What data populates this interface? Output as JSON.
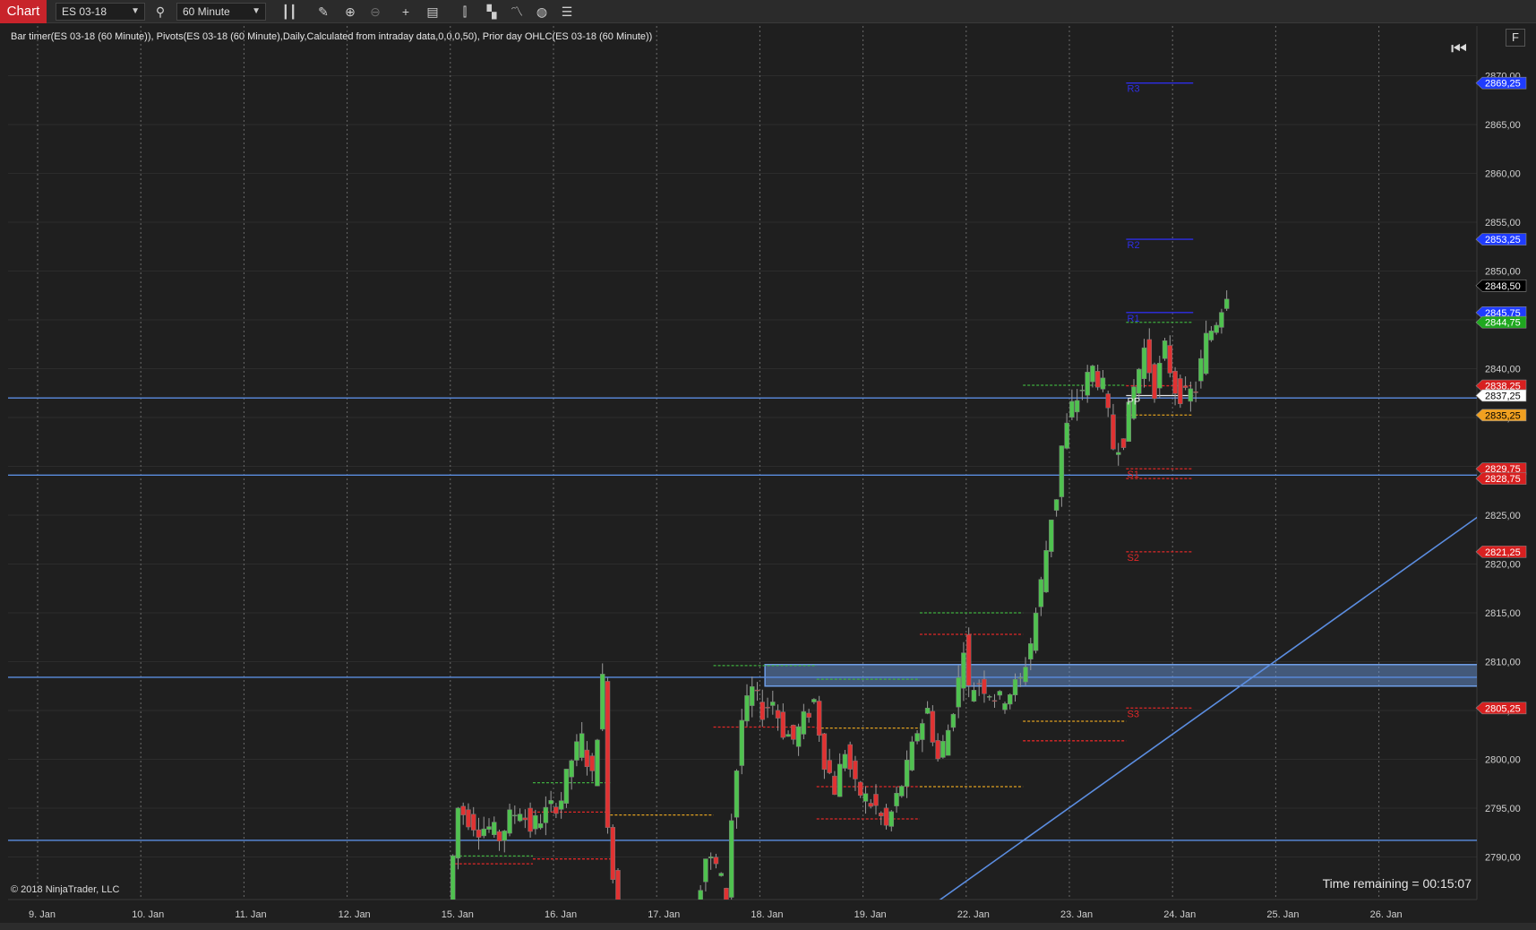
{
  "toolbar": {
    "chart_tab": "Chart",
    "instrument": "ES 03-18",
    "interval": "60 Minute",
    "icons": [
      "bar-type-icon",
      "draw-pencil-icon",
      "zoom-in-icon",
      "zoom-out-icon",
      "crosshair-icon",
      "data-box-icon",
      "bar-spacing-icon",
      "toggle-rows-icon",
      "strategy-icon",
      "refresh-icon",
      "properties-icon"
    ]
  },
  "indicator_label": "Bar timer(ES 03-18 (60 Minute)), Pivots(ES 03-18 (60 Minute),Daily,Calculated from intraday data,0,0,0,50), Prior day OHLC(ES 03-18 (60 Minute))",
  "copyright": "© 2018 NinjaTrader, LLC",
  "time_remaining": "Time remaining = 00:15:07",
  "f_button": "F",
  "chart_data": {
    "type": "candlestick",
    "instrument": "ES 03-18",
    "interval": "60 Minute",
    "x_ticks": [
      "9. Jan",
      "10. Jan",
      "11. Jan",
      "12. Jan",
      "15. Jan",
      "16. Jan",
      "17. Jan",
      "18. Jan",
      "19. Jan",
      "22. Jan",
      "23. Jan",
      "24. Jan",
      "25. Jan",
      "26. Jan"
    ],
    "y_ticks": [
      "2870,00",
      "2865,00",
      "2860,00",
      "2855,00",
      "2850,00",
      "2845,00",
      "2840,00",
      "2835,00",
      "2830,00",
      "2825,00",
      "2820,00",
      "2815,00",
      "2810,00",
      "2805,00",
      "2800,00",
      "2795,00",
      "2790,00"
    ],
    "y_tick_values": [
      2870,
      2865,
      2860,
      2855,
      2850,
      2845,
      2840,
      2835,
      2830,
      2825,
      2820,
      2815,
      2810,
      2805,
      2800,
      2795,
      2790
    ],
    "ylim": [
      2785.3,
      2874.5
    ],
    "grid": true,
    "colors": {
      "up": "#4fc24f",
      "down": "#e03232",
      "horizontal_line": "#5b8de0",
      "zone": "#6f9fe8",
      "r_levels": "#2e2ee8",
      "s_levels": "#e02828",
      "pp": "#e8e8e8",
      "prior_open": "#e0a020"
    },
    "price_labels": [
      {
        "text": "2869,25",
        "value": 2869.25,
        "bg": "#1f3cff",
        "fg": "#ffffff"
      },
      {
        "text": "2853,25",
        "value": 2853.25,
        "bg": "#1f3cff",
        "fg": "#ffffff"
      },
      {
        "text": "2848,50",
        "value": 2848.5,
        "bg": "#000000",
        "fg": "#ffffff"
      },
      {
        "text": "2845,75",
        "value": 2845.75,
        "bg": "#1f3cff",
        "fg": "#ffffff"
      },
      {
        "text": "2844,75",
        "value": 2844.75,
        "bg": "#1fa81f",
        "fg": "#ffffff"
      },
      {
        "text": "2838,25",
        "value": 2838.25,
        "bg": "#d82020",
        "fg": "#ffffff"
      },
      {
        "text": "2837,25",
        "value": 2837.25,
        "bg": "#ffffff",
        "fg": "#000000"
      },
      {
        "text": "2835,25",
        "value": 2835.25,
        "bg": "#f0a020",
        "fg": "#000000"
      },
      {
        "text": "2829,75",
        "value": 2829.75,
        "bg": "#d82020",
        "fg": "#ffffff"
      },
      {
        "text": "2828,75",
        "value": 2828.75,
        "bg": "#d82020",
        "fg": "#ffffff"
      },
      {
        "text": "2821,25",
        "value": 2821.25,
        "bg": "#d82020",
        "fg": "#ffffff"
      },
      {
        "text": "2805,25",
        "value": 2805.25,
        "bg": "#d82020",
        "fg": "#ffffff"
      }
    ],
    "pivot_labels": [
      {
        "text": "R3",
        "value": 2869.25,
        "color": "#2e2ee8"
      },
      {
        "text": "R2",
        "value": 2853.25,
        "color": "#2e2ee8"
      },
      {
        "text": "R1",
        "value": 2845.75,
        "color": "#2e2ee8"
      },
      {
        "text": "PP",
        "value": 2837.25,
        "color": "#e8e8e8"
      },
      {
        "text": "S1",
        "value": 2829.75,
        "color": "#e02828"
      },
      {
        "text": "S2",
        "value": 2821.25,
        "color": "#e02828"
      },
      {
        "text": "S3",
        "value": 2805.25,
        "color": "#e02828"
      }
    ],
    "horizontal_lines": [
      2837.0,
      2829.1,
      2808.4,
      2791.7
    ],
    "zone": {
      "top": 2809.7,
      "bottom": 2807.5,
      "x_start": 7.05,
      "x_end": 15.25
    },
    "trendline": {
      "x1": 8.0,
      "y1": 2780.0,
      "x2": 15.35,
      "y2": 2835.3
    },
    "level_segments": [
      {
        "x1": 4.0,
        "x2": 4.8,
        "y": 2790.1,
        "color": "#3fae3f"
      },
      {
        "x1": 4.0,
        "x2": 4.8,
        "y": 2789.3,
        "color": "#e02828"
      },
      {
        "x1": 4.8,
        "x2": 5.55,
        "y": 2797.6,
        "color": "#3fae3f"
      },
      {
        "x1": 4.8,
        "x2": 5.55,
        "y": 2794.6,
        "color": "#e02828"
      },
      {
        "x1": 4.8,
        "x2": 5.55,
        "y": 2789.8,
        "color": "#e02828"
      },
      {
        "x1": 5.55,
        "x2": 6.55,
        "y": 2794.3,
        "color": "#e0a020"
      },
      {
        "x1": 6.55,
        "x2": 7.55,
        "y": 2809.6,
        "color": "#3fae3f"
      },
      {
        "x1": 6.55,
        "x2": 7.55,
        "y": 2803.3,
        "color": "#e02828"
      },
      {
        "x1": 7.55,
        "x2": 8.55,
        "y": 2803.2,
        "color": "#e0a020"
      },
      {
        "x1": 7.55,
        "x2": 8.55,
        "y": 2808.2,
        "color": "#3fae3f"
      },
      {
        "x1": 7.55,
        "x2": 8.55,
        "y": 2797.2,
        "color": "#e02828"
      },
      {
        "x1": 7.55,
        "x2": 8.55,
        "y": 2793.9,
        "color": "#e02828"
      },
      {
        "x1": 8.55,
        "x2": 9.55,
        "y": 2815.0,
        "color": "#3fae3f"
      },
      {
        "x1": 8.55,
        "x2": 9.55,
        "y": 2812.8,
        "color": "#e02828"
      },
      {
        "x1": 8.55,
        "x2": 9.55,
        "y": 2797.2,
        "color": "#e0a020"
      },
      {
        "x1": 9.55,
        "x2": 10.55,
        "y": 2838.3,
        "color": "#3fae3f"
      },
      {
        "x1": 9.55,
        "x2": 10.55,
        "y": 2803.9,
        "color": "#e0a020"
      },
      {
        "x1": 9.55,
        "x2": 10.55,
        "y": 2801.9,
        "color": "#e02828"
      },
      {
        "x1": 10.55,
        "x2": 11.2,
        "y": 2869.25,
        "color": "#2e2ee8"
      },
      {
        "x1": 10.55,
        "x2": 11.2,
        "y": 2853.25,
        "color": "#2e2ee8"
      },
      {
        "x1": 10.55,
        "x2": 11.2,
        "y": 2845.75,
        "color": "#2e2ee8"
      },
      {
        "x1": 10.55,
        "x2": 11.2,
        "y": 2844.75,
        "color": "#3fae3f"
      },
      {
        "x1": 10.55,
        "x2": 11.2,
        "y": 2838.25,
        "color": "#e02828"
      },
      {
        "x1": 10.55,
        "x2": 11.2,
        "y": 2837.25,
        "color": "#e8e8e8"
      },
      {
        "x1": 10.55,
        "x2": 11.2,
        "y": 2835.25,
        "color": "#e0a020"
      },
      {
        "x1": 10.55,
        "x2": 11.2,
        "y": 2829.75,
        "color": "#e02828"
      },
      {
        "x1": 10.55,
        "x2": 11.2,
        "y": 2828.75,
        "color": "#e02828"
      },
      {
        "x1": 10.55,
        "x2": 11.2,
        "y": 2821.25,
        "color": "#e02828"
      },
      {
        "x1": 10.55,
        "x2": 11.2,
        "y": 2805.25,
        "color": "#e02828"
      }
    ],
    "price_path": [
      [
        4.0,
        2784
      ],
      [
        4.05,
        2790
      ],
      [
        4.1,
        2795
      ],
      [
        4.2,
        2794
      ],
      [
        4.3,
        2793
      ],
      [
        4.4,
        2793
      ],
      [
        4.5,
        2792
      ],
      [
        4.6,
        2794
      ],
      [
        4.7,
        2795
      ],
      [
        4.8,
        2793
      ],
      [
        4.9,
        2794
      ],
      [
        5.0,
        2795
      ],
      [
        5.1,
        2796
      ],
      [
        5.2,
        2800
      ],
      [
        5.3,
        2802
      ],
      [
        5.4,
        2798
      ],
      [
        5.5,
        2808
      ],
      [
        5.55,
        2794
      ],
      [
        5.6,
        2788
      ],
      [
        5.65,
        2784
      ],
      [
        6.4,
        2785
      ],
      [
        6.5,
        2790
      ],
      [
        6.6,
        2789
      ],
      [
        6.7,
        2786
      ],
      [
        6.75,
        2794
      ],
      [
        6.85,
        2804
      ],
      [
        6.95,
        2807
      ],
      [
        7.05,
        2805
      ],
      [
        7.15,
        2806
      ],
      [
        7.25,
        2803
      ],
      [
        7.35,
        2802
      ],
      [
        7.45,
        2804
      ],
      [
        7.55,
        2806
      ],
      [
        7.65,
        2800
      ],
      [
        7.75,
        2797
      ],
      [
        7.85,
        2801
      ],
      [
        7.95,
        2797
      ],
      [
        8.05,
        2796
      ],
      [
        8.15,
        2795
      ],
      [
        8.25,
        2793
      ],
      [
        8.35,
        2796
      ],
      [
        8.45,
        2799
      ],
      [
        8.55,
        2803
      ],
      [
        8.65,
        2805
      ],
      [
        8.75,
        2800
      ],
      [
        8.85,
        2803
      ],
      [
        8.95,
        2808
      ],
      [
        9.0,
        2812
      ],
      [
        9.05,
        2807
      ],
      [
        9.15,
        2808
      ],
      [
        9.25,
        2807
      ],
      [
        9.35,
        2806
      ],
      [
        9.45,
        2807
      ],
      [
        9.55,
        2808
      ],
      [
        9.65,
        2812
      ],
      [
        9.75,
        2818
      ],
      [
        9.85,
        2825
      ],
      [
        9.9,
        2827
      ],
      [
        9.95,
        2832
      ],
      [
        10.05,
        2836
      ],
      [
        10.15,
        2838
      ],
      [
        10.25,
        2840
      ],
      [
        10.35,
        2838
      ],
      [
        10.45,
        2832
      ],
      [
        10.55,
        2833
      ],
      [
        10.65,
        2838
      ],
      [
        10.75,
        2842
      ],
      [
        10.85,
        2838
      ],
      [
        10.95,
        2842
      ],
      [
        11.05,
        2838
      ],
      [
        11.15,
        2837
      ],
      [
        11.25,
        2838
      ],
      [
        11.35,
        2843
      ],
      [
        11.45,
        2845
      ],
      [
        11.55,
        2848
      ]
    ]
  }
}
